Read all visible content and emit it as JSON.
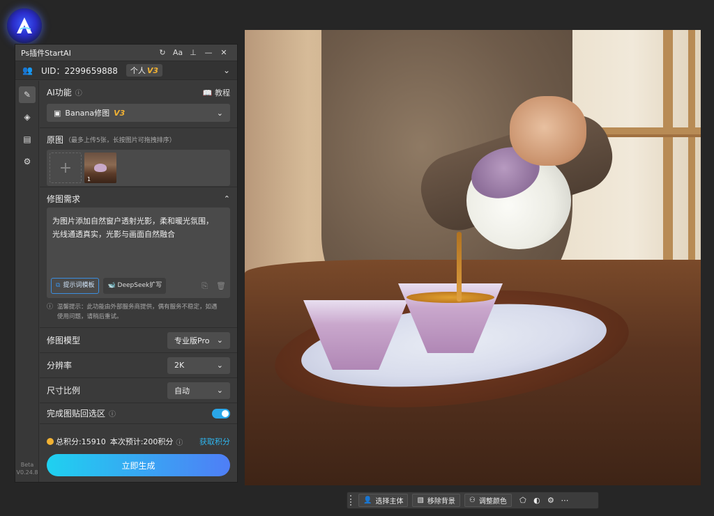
{
  "window": {
    "title": "Ps插件StartAI"
  },
  "titlebar_buttons": {
    "refresh": "↻",
    "font": "Aa",
    "pin": "📌",
    "min": "—",
    "close": "✕"
  },
  "user": {
    "uid": "UID：2299659888",
    "plan": "个人",
    "plan_version": "V3"
  },
  "ai_function": {
    "label": "AI功能",
    "tutorial": "教程",
    "model_select": "Banana修图",
    "model_version": "V3"
  },
  "original": {
    "label": "原图",
    "hint": "（最多上传5张，长按图片可拖拽排序）",
    "thumb_number": "1"
  },
  "requirement": {
    "label": "修图需求",
    "text_line1": "为图片添加自然窗户透射光影，柔和暖光氛围，",
    "text_line2": "光线通透真实，光影与画面自然融合",
    "template_button": "提示词模板",
    "deepseek_button": "DeepSeek扩写",
    "warning_line1": "温馨提示：此功能由外部服务商提供，偶有服务不稳定，如遇",
    "warning_line2": "使用问题，请稍后重试。"
  },
  "settings": {
    "model": {
      "label": "修图模型",
      "value": "专业版Pro"
    },
    "resolution": {
      "label": "分辨率",
      "value": "2K"
    },
    "ratio": {
      "label": "尺寸比例",
      "value": "自动"
    },
    "paste_back": {
      "label": "完成图贴回选区",
      "enabled": true
    }
  },
  "footer": {
    "points": "总积分:15910",
    "estimate": "本次预计:200积分",
    "get_points": "获取积分",
    "generate": "立即生成"
  },
  "beta": {
    "label": "Beta",
    "version": "V0.24.8"
  },
  "toolbar": {
    "select_subject": "选择主体",
    "remove_bg": "移除背景",
    "adjust_color": "调整颜色"
  },
  "colors": {
    "accent": "#2fb6ef",
    "gold": "#f2b233",
    "toggle": "#2aa6e8"
  }
}
